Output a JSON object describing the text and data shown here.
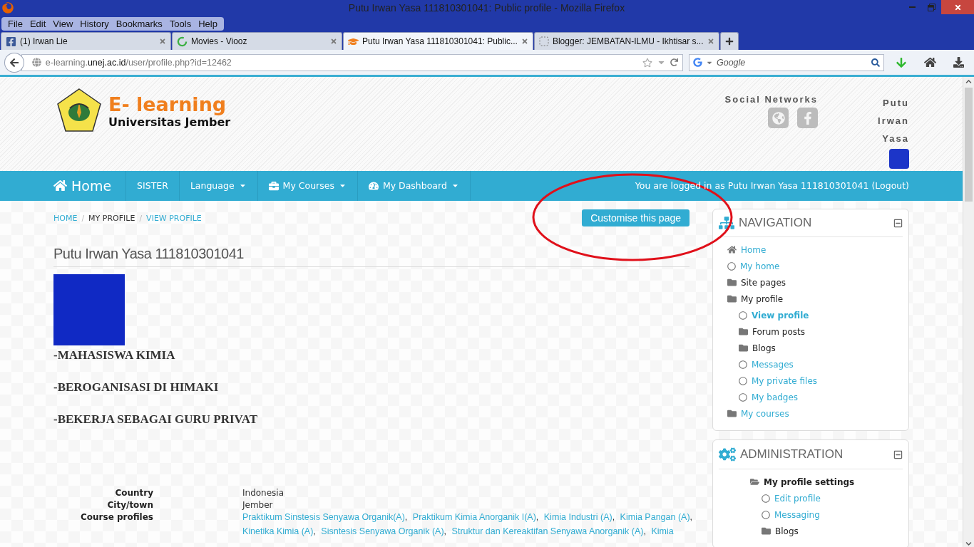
{
  "window": {
    "title": "Putu Irwan Yasa 111810301041: Public profile - Mozilla Firefox"
  },
  "menu": [
    "File",
    "Edit",
    "View",
    "History",
    "Bookmarks",
    "Tools",
    "Help"
  ],
  "tabs": [
    {
      "label": "(1) Irwan Lie",
      "kind": "facebook",
      "selected": false
    },
    {
      "label": "Movies - Viooz",
      "kind": "loading",
      "selected": false
    },
    {
      "label": "Putu Irwan Yasa 111810301041: Public...",
      "kind": "moodle",
      "selected": true
    },
    {
      "label": "Blogger: JEMBATAN-ILMU - Ikhtisar s...",
      "kind": "blank",
      "selected": false
    }
  ],
  "address": {
    "prefix": "e-learning.",
    "domain": "unej.ac.id",
    "path": "/user/profile.php?id=12462"
  },
  "search": {
    "placeholder": "Google"
  },
  "site": {
    "brand": "E- learning",
    "subtitle": "Universitas Jember",
    "social_title": "Social Networks",
    "user_name": "Putu Irwan Yasa"
  },
  "navbar": {
    "home": "Home",
    "items": [
      {
        "label": "SISTER",
        "kind": "plain",
        "dropdown": false
      },
      {
        "label": "Language",
        "kind": "plain",
        "dropdown": true
      },
      {
        "label": "My Courses",
        "kind": "courses",
        "dropdown": true
      },
      {
        "label": "My Dashboard",
        "kind": "dashboard",
        "dropdown": true
      }
    ],
    "login_text": "You are logged in as Putu Irwan Yasa 111810301041",
    "logout": "(Logout)"
  },
  "breadcrumb": {
    "separator": "/",
    "items": [
      {
        "label": "HOME",
        "link": true
      },
      {
        "label": "MY PROFILE",
        "link": false
      },
      {
        "label": "VIEW PROFILE",
        "link": true
      }
    ]
  },
  "customise_button": "Customise this page",
  "profile": {
    "heading": "Putu Irwan Yasa 111810301041",
    "description": [
      "-MAHASISWA KIMIA",
      "-BEROGANISASI DI HIMAKI",
      "-BEKERJA SEBAGAI GURU PRIVAT"
    ],
    "fields": [
      {
        "label": "Country",
        "kind": "text",
        "value": "Indonesia"
      },
      {
        "label": "City/town",
        "kind": "text",
        "value": "Jember"
      },
      {
        "label": "Course profiles",
        "kind": "links",
        "separator": ",",
        "links": [
          "Praktikum Sinstesis Senyawa Organik(A)",
          "Praktikum Kimia Anorganik I(A)",
          "Kimia Industri (A)",
          "Kimia Pangan (A)",
          "Kinetika Kimia (A)",
          "Sisntesis Senyawa Organik (A)",
          "Struktur dan Kereaktifan Senyawa Anorganik (A)",
          "Kimia"
        ]
      }
    ]
  },
  "navigation": {
    "title": "NAVIGATION",
    "items": [
      {
        "label": "Home",
        "kind": "home",
        "link": true,
        "bold": false
      },
      {
        "label": "My home",
        "kind": "page",
        "link": true,
        "bold": false
      },
      {
        "label": "Site pages",
        "kind": "folder",
        "link": false,
        "bold": false
      },
      {
        "label": "My profile",
        "kind": "folder",
        "link": false,
        "bold": false,
        "children": [
          {
            "label": "View profile",
            "kind": "page",
            "link": true,
            "bold": true
          },
          {
            "label": "Forum posts",
            "kind": "folder",
            "link": false,
            "bold": false
          },
          {
            "label": "Blogs",
            "kind": "folder",
            "link": false,
            "bold": false
          },
          {
            "label": "Messages",
            "kind": "page",
            "link": true,
            "bold": false
          },
          {
            "label": "My private files",
            "kind": "page",
            "link": true,
            "bold": false
          },
          {
            "label": "My badges",
            "kind": "page",
            "link": true,
            "bold": false
          }
        ]
      },
      {
        "label": "My courses",
        "kind": "folder",
        "link": true,
        "bold": false
      }
    ]
  },
  "administration": {
    "title": "ADMINISTRATION",
    "items": [
      {
        "label": "My profile settings",
        "kind": "expanded",
        "link": false,
        "bold": true,
        "children": [
          {
            "label": "Edit profile",
            "kind": "page",
            "link": true,
            "bold": false
          },
          {
            "label": "Messaging",
            "kind": "page",
            "link": true,
            "bold": false
          },
          {
            "label": "Blogs",
            "kind": "folder",
            "link": false,
            "bold": false
          }
        ]
      }
    ]
  }
}
